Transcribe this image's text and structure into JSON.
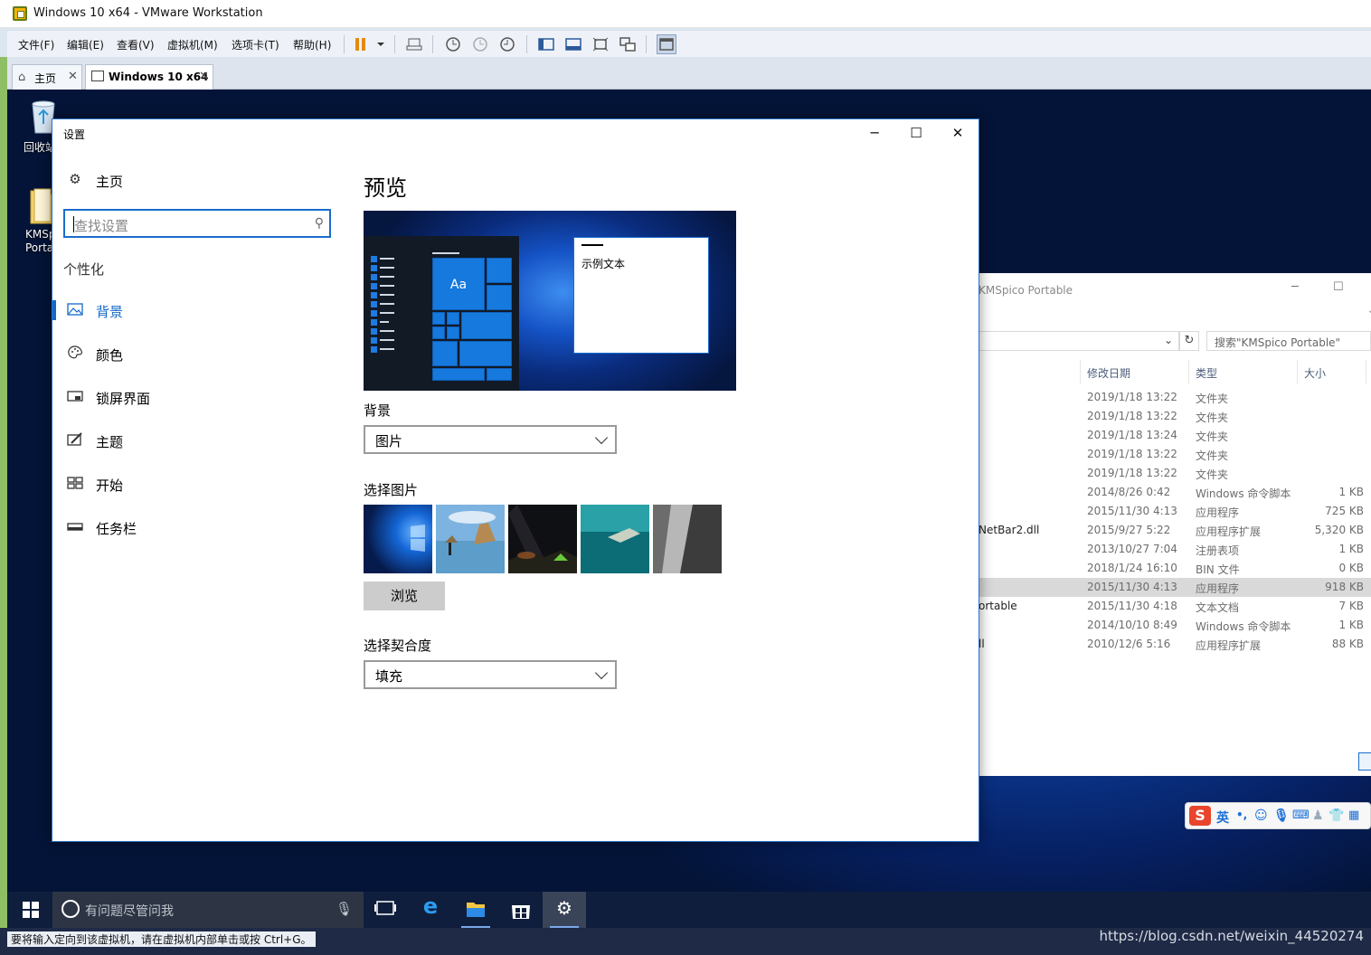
{
  "host": {
    "window_title": "Windows 10 x64 - VMware Workstation",
    "menu": [
      "文件(F)",
      "编辑(E)",
      "查看(V)",
      "虚拟机(M)",
      "选项卡(T)",
      "帮助(H)"
    ],
    "tabs": [
      {
        "label": "主页",
        "close": "✕"
      },
      {
        "label": "Windows 10 x64",
        "close": "✕"
      }
    ],
    "status_text": "要将输入定向到该虚拟机，请在虚拟机内部单击或按 Ctrl+G。",
    "watermark": "https://blog.csdn.net/weixin_44520274"
  },
  "desktop": {
    "icons": [
      {
        "label": "回收站",
        "icon": "recycle-bin-icon"
      },
      {
        "label": "KMSpico Portable",
        "icon": "folder-icon"
      }
    ]
  },
  "explorer": {
    "title": "KMSpico Portable",
    "search_placeholder": "搜索\"KMSpico Portable\"",
    "columns": [
      "修改日期",
      "类型",
      "大小"
    ],
    "rows": [
      {
        "name": "",
        "date": "2019/1/18 13:22",
        "type": "文件夹",
        "size": ""
      },
      {
        "name": "",
        "date": "2019/1/18 13:22",
        "type": "文件夹",
        "size": ""
      },
      {
        "name": "",
        "date": "2019/1/18 13:24",
        "type": "文件夹",
        "size": ""
      },
      {
        "name": "",
        "date": "2019/1/18 13:22",
        "type": "文件夹",
        "size": ""
      },
      {
        "name": "",
        "date": "2019/1/18 13:22",
        "type": "文件夹",
        "size": ""
      },
      {
        "name": "",
        "date": "2014/8/26 0:42",
        "type": "Windows 命令脚本",
        "size": "1 KB"
      },
      {
        "name": "",
        "date": "2015/11/30 4:13",
        "type": "应用程序",
        "size": "725 KB"
      },
      {
        "name": "NetBar2.dll",
        "date": "2015/9/27 5:22",
        "type": "应用程序扩展",
        "size": "5,320 KB"
      },
      {
        "name": "",
        "date": "2013/10/27 7:04",
        "type": "注册表项",
        "size": "1 KB"
      },
      {
        "name": "",
        "date": "2018/1/24 16:10",
        "type": "BIN 文件",
        "size": "0 KB"
      },
      {
        "name": "",
        "date": "2015/11/30 4:13",
        "type": "应用程序",
        "size": "918 KB",
        "selected": true
      },
      {
        "name": "ortable",
        "date": "2015/11/30 4:18",
        "type": "文本文档",
        "size": "7 KB"
      },
      {
        "name": "",
        "date": "2014/10/10 8:49",
        "type": "Windows 命令脚本",
        "size": "1 KB"
      },
      {
        "name": "ll",
        "date": "2010/12/6 5:16",
        "type": "应用程序扩展",
        "size": "88 KB"
      }
    ]
  },
  "ime": {
    "mode": "英"
  },
  "settings": {
    "window_title": "设置",
    "home_label": "主页",
    "search_placeholder": "查找设置",
    "section": "个性化",
    "nav": [
      {
        "label": "背景",
        "icon": "picture-icon",
        "active": true
      },
      {
        "label": "颜色",
        "icon": "palette-icon"
      },
      {
        "label": "锁屏界面",
        "icon": "lock-screen-icon"
      },
      {
        "label": "主题",
        "icon": "theme-icon"
      },
      {
        "label": "开始",
        "icon": "start-grid-icon"
      },
      {
        "label": "任务栏",
        "icon": "taskbar-icon"
      }
    ],
    "page_title": "预览",
    "preview_sample_text": "示例文本",
    "preview_tile_text": "Aa",
    "background_label": "背景",
    "background_value": "图片",
    "choose_picture_label": "选择图片",
    "browse_label": "浏览",
    "fit_label": "选择契合度",
    "fit_value": "填充"
  },
  "taskbar": {
    "search_placeholder": "有问题尽管问我",
    "apps": [
      "task-view-icon",
      "edge-icon",
      "file-explorer-icon",
      "store-icon",
      "settings-icon"
    ]
  }
}
